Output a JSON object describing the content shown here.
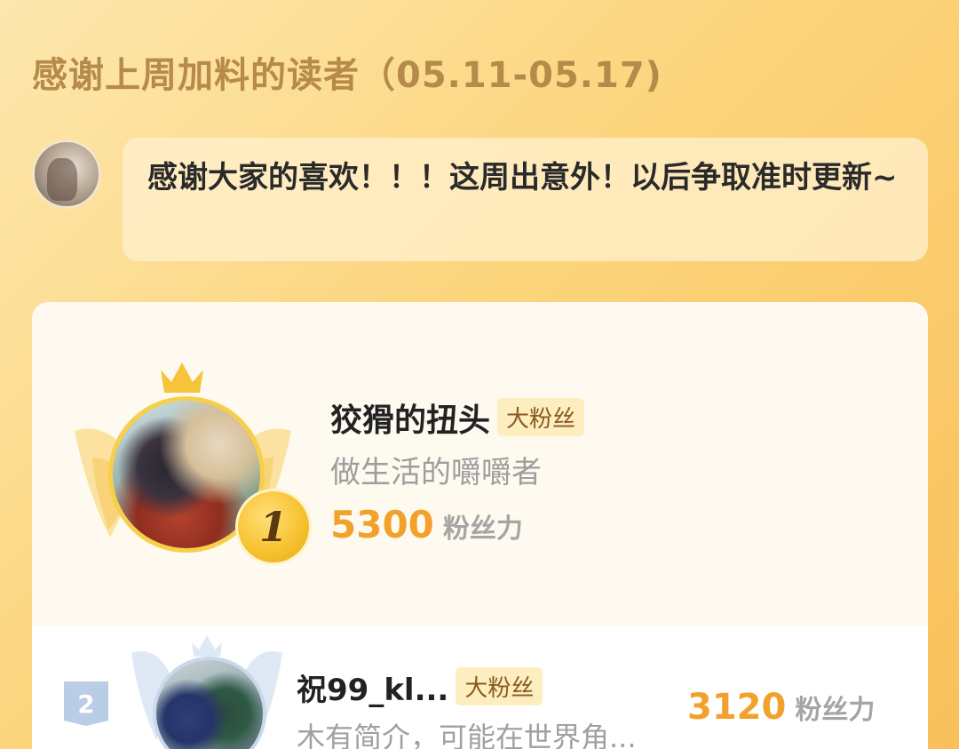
{
  "header": {
    "title": "感谢上周加料的读者（05.11-05.17)"
  },
  "author_message": {
    "text": "感谢大家的喜欢！！！这周出意外！以后争取准时更新~"
  },
  "leaderboard": [
    {
      "rank": "1",
      "name": "狡猾的扭头",
      "tag": "大粉丝",
      "signature": "做生活的嚼嚼者",
      "score": "5300",
      "unit": "粉丝力"
    },
    {
      "rank": "2",
      "name": "祝99_kl...",
      "tag": "大粉丝",
      "signature": "木有简介，可能在世界角...",
      "score": "3120",
      "unit": "粉丝力"
    }
  ],
  "colors": {
    "accent_gold": "#f2a22c",
    "title_brown": "#b58a4a",
    "tag_bg": "#fdeec0"
  },
  "icons": [
    "crown-icon",
    "wings-icon",
    "rank-medal-icon",
    "rank-flag-icon"
  ]
}
